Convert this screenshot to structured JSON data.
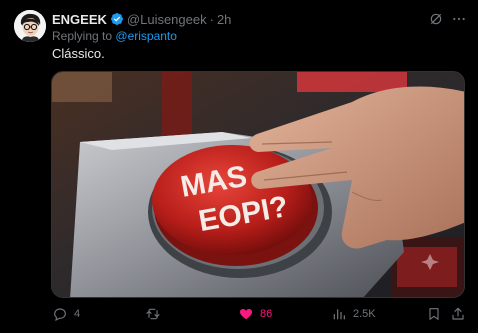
{
  "author": {
    "display_name": "ENGEEK",
    "handle": "@Luisengeek",
    "separator": "·",
    "time": "2h",
    "verified": true
  },
  "reply": {
    "prefix": "Replying to",
    "mention": "@erispanto"
  },
  "tweet": {
    "text": "Clássico."
  },
  "media": {
    "button_text_line1": "MAS",
    "button_text_line2": "EOPI?"
  },
  "actions": {
    "replies": "4",
    "retweets": "",
    "likes": "86",
    "views": "2.5K"
  },
  "colors": {
    "background": "#000000",
    "text_primary": "#e7e9ea",
    "text_secondary": "#71767b",
    "link": "#1d9bf0",
    "like": "#f91880",
    "verified": "#1d9bf0"
  }
}
